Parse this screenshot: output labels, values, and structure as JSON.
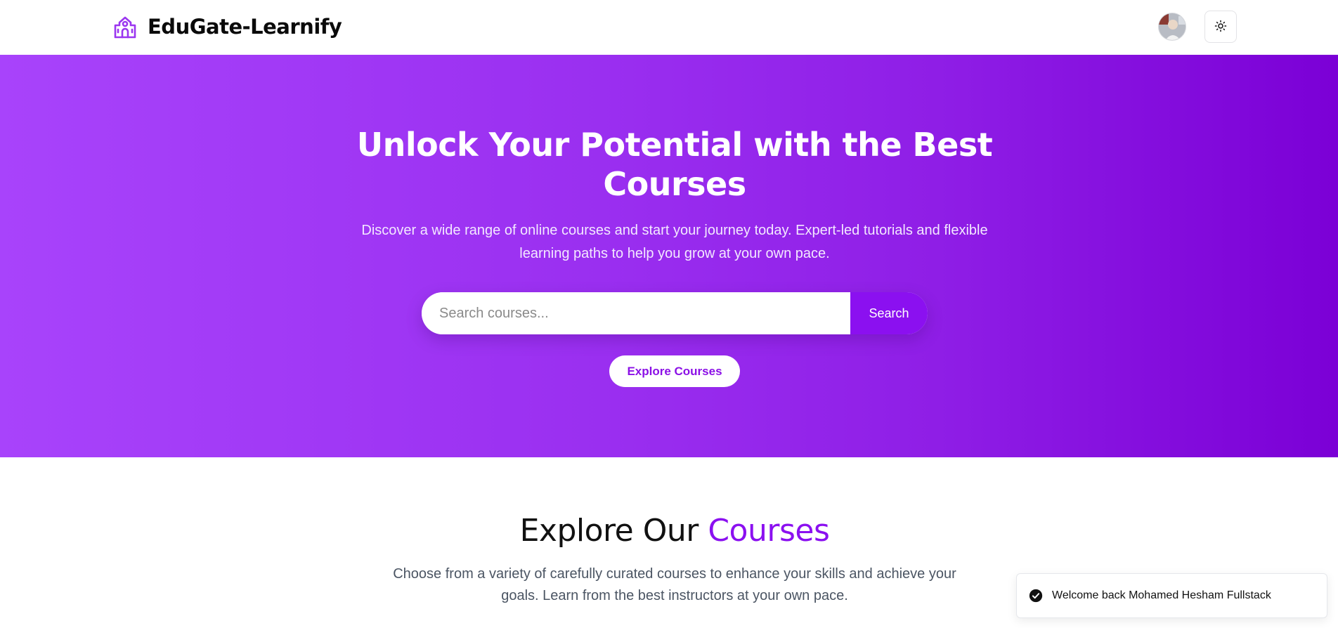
{
  "navbar": {
    "brand_name": "EduGate-Learnify",
    "icons": {
      "logo": "school-building-icon",
      "theme": "sun-icon"
    }
  },
  "hero": {
    "title": "Unlock Your Potential with the Best Courses",
    "subtitle": "Discover a wide range of online courses and start your journey today. Expert-led tutorials and flexible learning paths to help you grow at your own pace.",
    "search": {
      "placeholder": "Search courses...",
      "button_label": "Search"
    },
    "explore_button_label": "Explore Courses",
    "gradient_colors": [
      "#a843fb",
      "#7b00d6"
    ]
  },
  "section": {
    "title_part1": "Explore Our",
    "title_part2": "Courses",
    "subtitle": "Choose from a variety of carefully curated courses to enhance your skills and achieve your goals. Learn from the best instructors at your own pace."
  },
  "toast": {
    "message": "Welcome back Mohamed Hesham Fullstack",
    "icon": "check-circle-icon"
  },
  "colors": {
    "accent": "#8b10f0",
    "white": "#ffffff",
    "text_gray": "#4b5563"
  }
}
